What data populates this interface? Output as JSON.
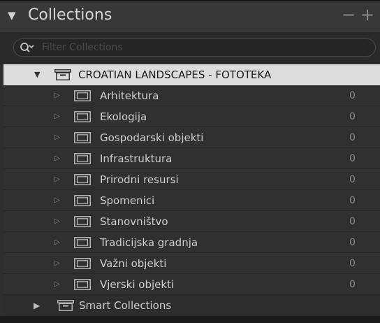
{
  "panel": {
    "title": "Collections",
    "minus_label": "−",
    "plus_label": "+",
    "colors": {
      "background": "#2e2e2e",
      "header": "#383838",
      "selected_row": "#dcdcdc"
    }
  },
  "filter": {
    "placeholder": "Filter Collections",
    "value": ""
  },
  "collection_set": {
    "name": "CROATIAN LANDSCAPES - FOTOTEKA",
    "expanded": true,
    "selected": true,
    "children": [
      {
        "name": "Arhitektura",
        "count": "0"
      },
      {
        "name": "Ekologija",
        "count": "0"
      },
      {
        "name": "Gospodarski objekti",
        "count": "0"
      },
      {
        "name": "Infrastruktura",
        "count": "0"
      },
      {
        "name": "Prirodni resursi",
        "count": "0"
      },
      {
        "name": "Spomenici",
        "count": "0"
      },
      {
        "name": "Stanovništvo",
        "count": "0"
      },
      {
        "name": "Tradicijska gradnja",
        "count": "0"
      },
      {
        "name": "Važni objekti",
        "count": "0"
      },
      {
        "name": "Vjerski objekti",
        "count": "0"
      }
    ]
  },
  "smart_collections": {
    "name": "Smart Collections",
    "expanded": false
  }
}
